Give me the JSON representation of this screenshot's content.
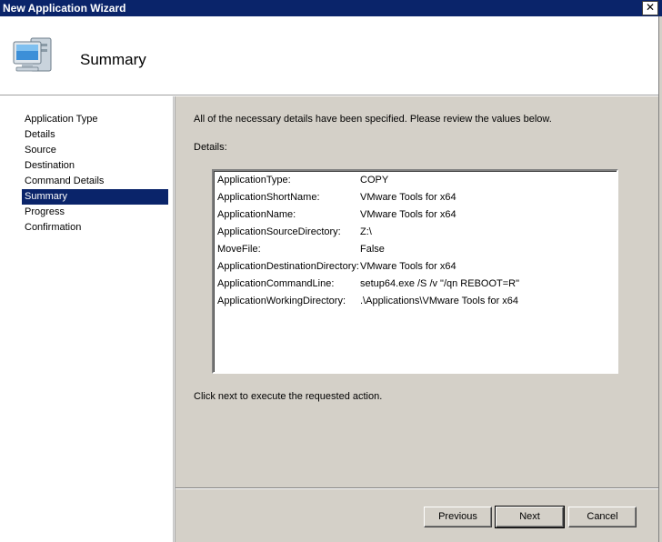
{
  "window": {
    "title": "New Application Wizard",
    "close_glyph": "✕"
  },
  "header": {
    "icon": "computer-icon",
    "page_title": "Summary"
  },
  "sidebar": {
    "items": [
      {
        "label": "Application Type",
        "active": false
      },
      {
        "label": "Details",
        "active": false
      },
      {
        "label": "Source",
        "active": false
      },
      {
        "label": "Destination",
        "active": false
      },
      {
        "label": "Command Details",
        "active": false
      },
      {
        "label": "Summary",
        "active": true
      },
      {
        "label": "Progress",
        "active": false
      },
      {
        "label": "Confirmation",
        "active": false
      }
    ]
  },
  "main": {
    "intro": "All of the necessary details have been specified.  Please review the values below.",
    "details_label": "Details:",
    "details": [
      {
        "key": "ApplicationType:",
        "value": "COPY"
      },
      {
        "key": "ApplicationShortName:",
        "value": "VMware Tools for x64"
      },
      {
        "key": "ApplicationName:",
        "value": "VMware Tools for x64"
      },
      {
        "key": "ApplicationSourceDirectory:",
        "value": "Z:\\"
      },
      {
        "key": "MoveFile:",
        "value": "False"
      },
      {
        "key": "ApplicationDestinationDirectory:",
        "value": "VMware Tools for x64"
      },
      {
        "key": "ApplicationCommandLine:",
        "value": "setup64.exe /S /v \"/qn REBOOT=R\""
      },
      {
        "key": "ApplicationWorkingDirectory:",
        "value": ".\\Applications\\VMware Tools for x64"
      }
    ],
    "footer_text": "Click next to execute the requested action."
  },
  "buttons": {
    "previous": "Previous",
    "next": "Next",
    "cancel": "Cancel"
  },
  "colors": {
    "selection": "#0a246a",
    "dialog_face": "#d4d0c8"
  }
}
